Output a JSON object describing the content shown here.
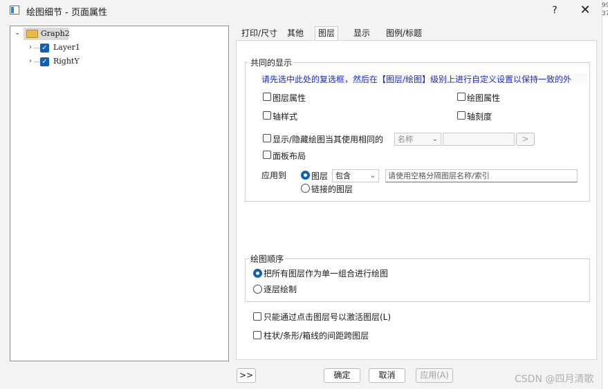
{
  "window": {
    "title": "绘图细节 - 页面属性",
    "help": "?",
    "close": "✕",
    "edge_text": "99 37"
  },
  "tree": {
    "root": "Graph2",
    "children": [
      "Layer1",
      "RightY"
    ]
  },
  "tabs": [
    "打印/尺寸",
    "其他",
    "图层",
    "显示",
    "图例/标题"
  ],
  "active_tab": "图层",
  "common": {
    "title": "共同的显示",
    "note": "请先选中此处的复选框，然后在【图层/绘图】级别上进行自定义设置以保持一致的外",
    "layer_props": "图层属性",
    "plot_props": "绘图属性",
    "axis_style": "轴样式",
    "axis_ticks": "轴刻度",
    "show_hide": "显示/隐藏绘图当其使用相同的",
    "name_combo": "名称",
    "name_btn": ">",
    "panel_layout": "面板布局",
    "apply_to": "应用到",
    "layer_radio": "图层",
    "include_combo": "包含",
    "layer_name_placeholder": "请使用空格分隔图层名称/索引",
    "linked_layers": "链接的图层"
  },
  "order": {
    "title": "绘图顺序",
    "single_group": "把所有图层作为单一组合进行绘图",
    "layer_by_layer": "逐层绘制"
  },
  "options": {
    "activate_by_click": "只能通过点击图层号以激活图层(L)",
    "bar_spacing": "柱状/条形/箱线的间距跨图层"
  },
  "footer": {
    "more": ">>",
    "ok": "确定",
    "cancel": "取消",
    "apply": "应用(A)"
  },
  "watermark": "CSDN @四月清歌",
  "colors": {
    "accent": "#1160b8",
    "note_text": "#1a2bd6"
  }
}
